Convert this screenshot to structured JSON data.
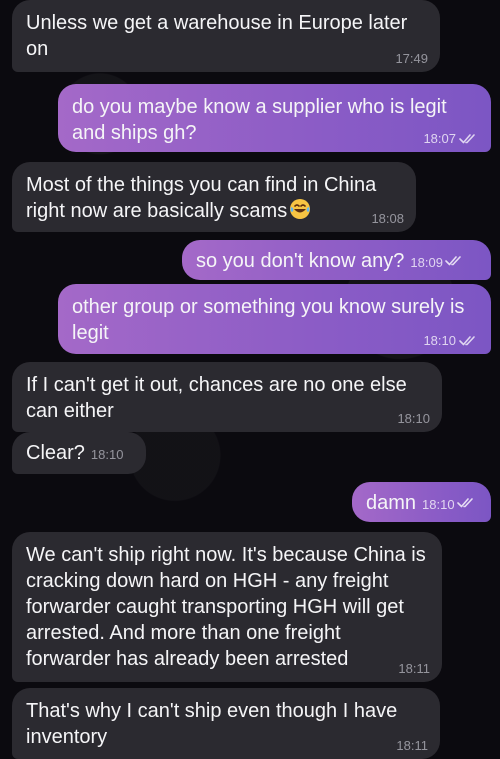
{
  "messages": [
    {
      "side": "in",
      "text": "Unless we get a warehouse in Europe later on",
      "time": "17:49"
    },
    {
      "side": "out",
      "text": "do you maybe know a supplier who is legit and ships gh?",
      "time": "18:07",
      "read": true
    },
    {
      "side": "in",
      "text": "Most of the things you can find in China right now are basically scams",
      "time": "18:08",
      "emoji": "laughing-tears-emoji-icon"
    },
    {
      "side": "out",
      "text": "so you don't know any?",
      "time": "18:09",
      "read": true
    },
    {
      "side": "out",
      "text": "other group or something you know surely is legit",
      "time": "18:10",
      "read": true
    },
    {
      "side": "in",
      "text": "If I can't get it out, chances are no one else can either",
      "time": "18:10"
    },
    {
      "side": "in",
      "text": "Clear?",
      "time": "18:10"
    },
    {
      "side": "out",
      "text": "damn",
      "time": "18:10",
      "read": true
    },
    {
      "side": "in",
      "text": "We can't ship right now. It's because China is cracking down hard on HGH - any freight forwarder caught transporting HGH will get arrested. And more than one freight forwarder has already been arrested",
      "time": "18:11"
    },
    {
      "side": "in",
      "text": "That's why I can't ship even though I have inventory",
      "time": "18:11"
    }
  ],
  "colors": {
    "incoming_bubble": "#2b2a30",
    "outgoing_bubble_start": "#a469c8",
    "outgoing_bubble_end": "#7c56c4",
    "background": "#0b0a0f"
  }
}
